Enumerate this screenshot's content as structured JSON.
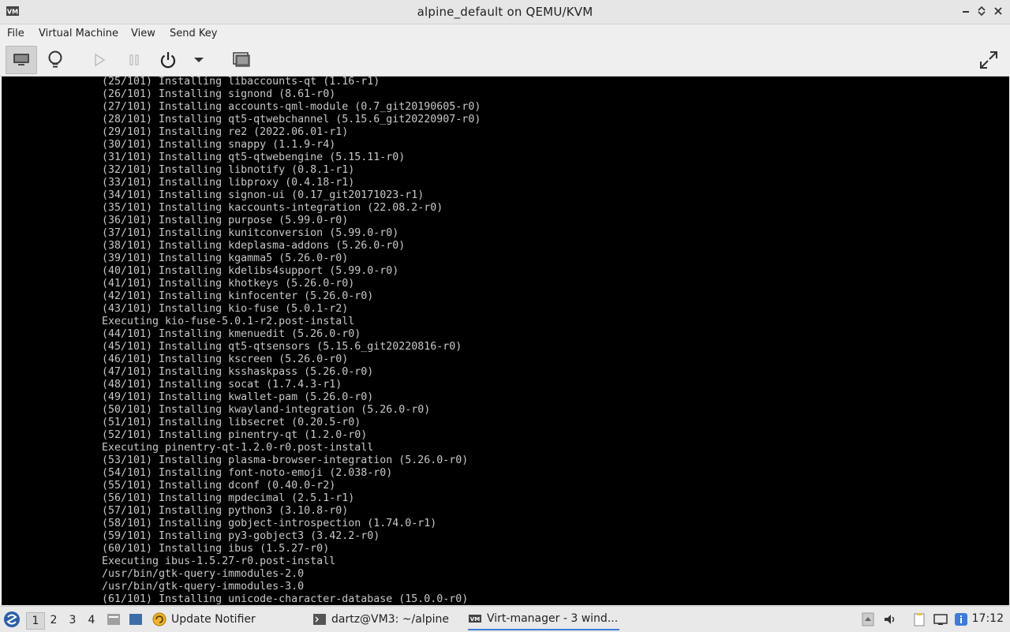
{
  "window": {
    "title": "alpine_default on QEMU/KVM",
    "controls": [
      "minimize",
      "maximize",
      "close"
    ]
  },
  "menubar": {
    "items": [
      "File",
      "Virtual Machine",
      "View",
      "Send Key"
    ]
  },
  "toolbar": {
    "buttons": [
      "show-console",
      "show-details",
      "run",
      "pause",
      "shutdown",
      "shutdown-menu",
      "screenshots",
      "fullscreen"
    ]
  },
  "console": {
    "lines": [
      "(25/101) Installing libaccounts-qt (1.16-r1)",
      "(26/101) Installing signond (8.61-r0)",
      "(27/101) Installing accounts-qml-module (0.7_git20190605-r0)",
      "(28/101) Installing qt5-qtwebchannel (5.15.6_git20220907-r0)",
      "(29/101) Installing re2 (2022.06.01-r1)",
      "(30/101) Installing snappy (1.1.9-r4)",
      "(31/101) Installing qt5-qtwebengine (5.15.11-r0)",
      "(32/101) Installing libnotify (0.8.1-r1)",
      "(33/101) Installing libproxy (0.4.18-r1)",
      "(34/101) Installing signon-ui (0.17_git20171023-r1)",
      "(35/101) Installing kaccounts-integration (22.08.2-r0)",
      "(36/101) Installing purpose (5.99.0-r0)",
      "(37/101) Installing kunitconversion (5.99.0-r0)",
      "(38/101) Installing kdeplasma-addons (5.26.0-r0)",
      "(39/101) Installing kgamma5 (5.26.0-r0)",
      "(40/101) Installing kdelibs4support (5.99.0-r0)",
      "(41/101) Installing khotkeys (5.26.0-r0)",
      "(42/101) Installing kinfocenter (5.26.0-r0)",
      "(43/101) Installing kio-fuse (5.0.1-r2)",
      "Executing kio-fuse-5.0.1-r2.post-install",
      "(44/101) Installing kmenuedit (5.26.0-r0)",
      "(45/101) Installing qt5-qtsensors (5.15.6_git20220816-r0)",
      "(46/101) Installing kscreen (5.26.0-r0)",
      "(47/101) Installing ksshaskpass (5.26.0-r0)",
      "(48/101) Installing socat (1.7.4.3-r1)",
      "(49/101) Installing kwallet-pam (5.26.0-r0)",
      "(50/101) Installing kwayland-integration (5.26.0-r0)",
      "(51/101) Installing libsecret (0.20.5-r0)",
      "(52/101) Installing pinentry-qt (1.2.0-r0)",
      "Executing pinentry-qt-1.2.0-r0.post-install",
      "(53/101) Installing plasma-browser-integration (5.26.0-r0)",
      "(54/101) Installing font-noto-emoji (2.038-r0)",
      "(55/101) Installing dconf (0.40.0-r2)",
      "(56/101) Installing mpdecimal (2.5.1-r1)",
      "(57/101) Installing python3 (3.10.8-r0)",
      "(58/101) Installing gobject-introspection (1.74.0-r1)",
      "(59/101) Installing py3-gobject3 (3.42.2-r0)",
      "(60/101) Installing ibus (1.5.27-r0)",
      "Executing ibus-1.5.27-r0.post-install",
      "/usr/bin/gtk-query-immodules-2.0",
      "/usr/bin/gtk-query-immodules-3.0",
      "(61/101) Installing unicode-character-database (15.0.0-r0)"
    ]
  },
  "taskbar": {
    "workspaces": [
      "1",
      "2",
      "3",
      "4"
    ],
    "active_workspace": "1",
    "tasks": [
      {
        "label": "Update Notifier",
        "icon": "update-notifier-icon"
      },
      {
        "label": "dartz@VM3: ~/alpine",
        "icon": "terminal-icon"
      },
      {
        "label": "Virt-manager - 3 wind...",
        "icon": "virt-manager-icon"
      }
    ],
    "clock": "17:12"
  }
}
